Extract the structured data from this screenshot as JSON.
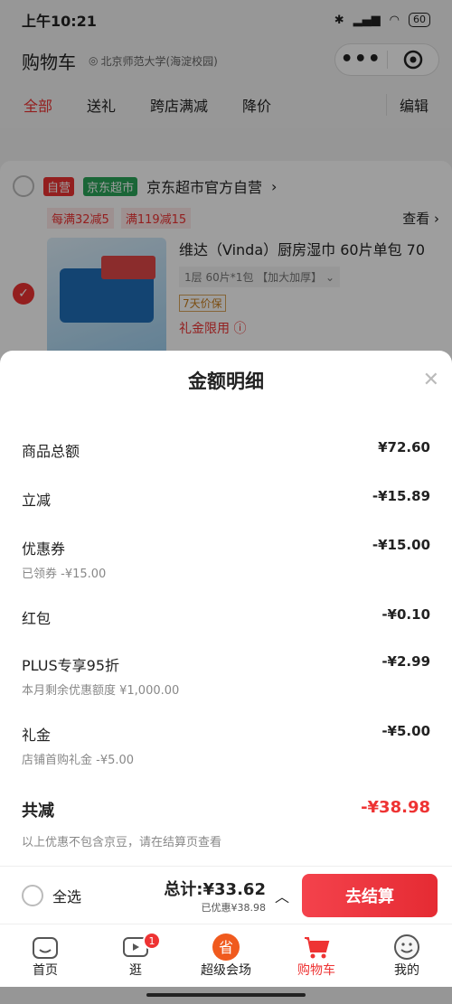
{
  "statusbar": {
    "time": "上午10:21",
    "battery": "60"
  },
  "header": {
    "title": "购物车",
    "location": "北京师范大学(海淀校园)"
  },
  "tabs": [
    "全部",
    "送礼",
    "跨店满减",
    "降价"
  ],
  "edit_label": "编辑",
  "store": {
    "tag_self": "自营",
    "tag_market": "京东超市",
    "name": "京东超市官方自营",
    "promos": [
      "每满32减5",
      "满119减15"
    ],
    "look": "查看",
    "item": {
      "title": "维达（Vinda）厨房湿巾 60片单包 70",
      "spec": "1层 60片*1包 【加大加厚】",
      "guarantee": "7天价保",
      "limit": "礼金限用"
    }
  },
  "sheet": {
    "title": "金额明细",
    "rows": [
      {
        "label": "商品总额",
        "amount": "¥72.60",
        "note": ""
      },
      {
        "label": "立减",
        "amount": "-¥15.89",
        "note": ""
      },
      {
        "label": "优惠券",
        "amount": "-¥15.00",
        "note": "已领券 -¥15.00"
      },
      {
        "label": "红包",
        "amount": "-¥0.10",
        "note": ""
      },
      {
        "label": "PLUS专享95折",
        "amount": "-¥2.99",
        "note": "本月剩余优惠额度 ¥1,000.00"
      },
      {
        "label": "礼金",
        "amount": "-¥5.00",
        "note": "店铺首购礼金 -¥5.00"
      }
    ],
    "total_label": "共减",
    "total_amount": "-¥38.98",
    "footnote": "以上优惠不包含京豆，请在结算页查看"
  },
  "bottom": {
    "select_all": "全选",
    "total": "总计:¥33.62",
    "saved": "已优惠¥38.98",
    "checkout": "去结算"
  },
  "tabbar": [
    {
      "label": "首页",
      "icon": "home-icon"
    },
    {
      "label": "逛",
      "icon": "video-icon",
      "badge": "1"
    },
    {
      "label": "超级会场",
      "icon": "venue-icon"
    },
    {
      "label": "购物车",
      "icon": "cart-icon"
    },
    {
      "label": "我的",
      "icon": "profile-icon"
    }
  ],
  "colors": {
    "accent": "#e33333",
    "green": "#2aa55a"
  }
}
